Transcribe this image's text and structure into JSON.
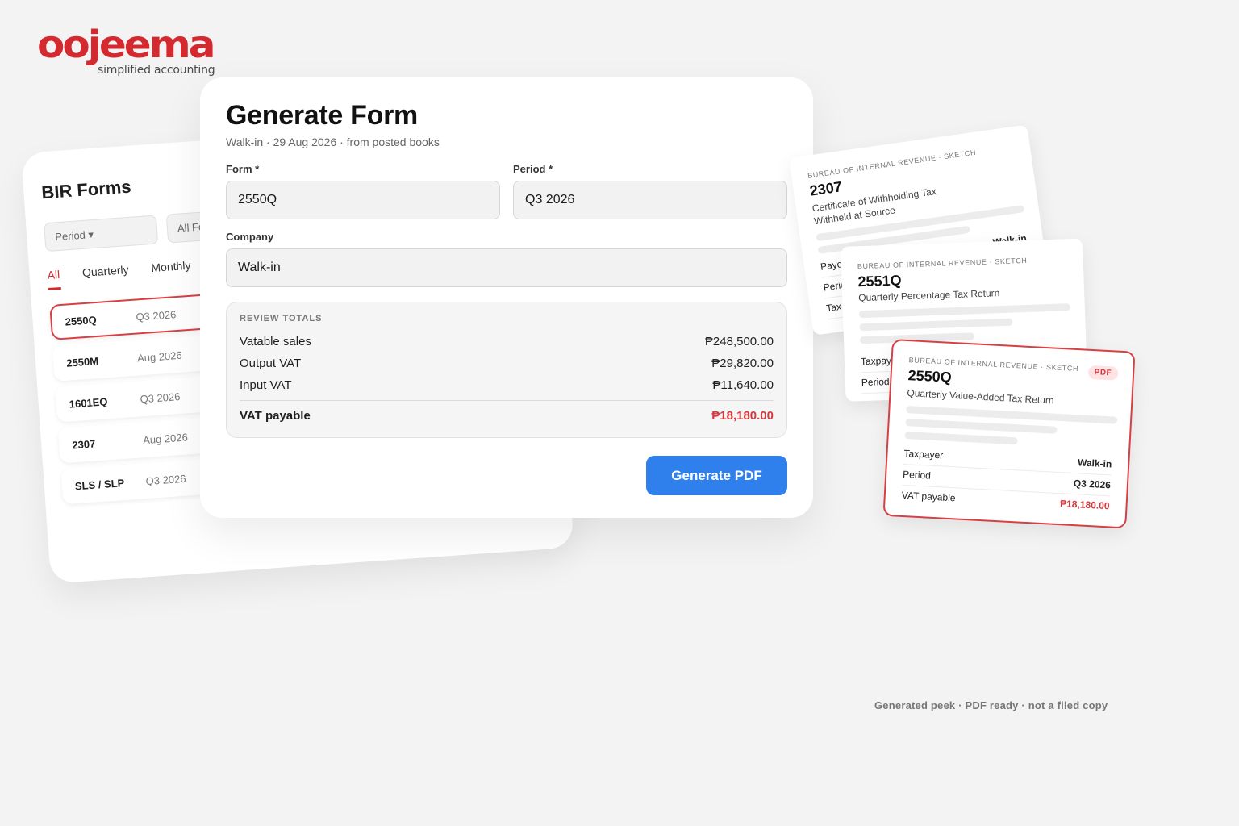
{
  "brand": {
    "name": "oojeema",
    "tagline": "simplified accounting",
    "accent": "#d42a2f"
  },
  "bir": {
    "title": "BIR Forms",
    "filters": {
      "period": "Period ▾",
      "forms": "All Fo"
    },
    "tabs": [
      "All",
      "Quarterly",
      "Monthly"
    ],
    "rows": [
      {
        "code": "2550Q",
        "period": "Q3 2026"
      },
      {
        "code": "2550M",
        "period": "Aug 2026"
      },
      {
        "code": "1601EQ",
        "period": "Q3 2026"
      },
      {
        "code": "2307",
        "period": "Aug 2026"
      },
      {
        "code": "SLS / SLP",
        "period": "Q3 2026"
      }
    ]
  },
  "form": {
    "title": "Generate Form",
    "subtitle": "Walk-in · 29 Aug 2026 · from posted books",
    "form_label": "Form *",
    "form_value": "2550Q",
    "period_label": "Period *",
    "period_value": "Q3 2026",
    "company_label": "Company",
    "company_value": "Walk-in",
    "review": {
      "heading": "REVIEW TOTALS",
      "vatable_label": "Vatable sales",
      "vatable_value": "₱248,500.00",
      "output_label": "Output VAT",
      "output_value": "₱29,820.00",
      "input_label": "Input VAT",
      "input_value": "₱11,640.00",
      "payable_label": "VAT payable",
      "payable_value": "₱18,180.00"
    },
    "button": "Generate PDF",
    "button_color": "#2f80ed"
  },
  "docs": {
    "d1": {
      "head": "BUREAU OF INTERNAL REVENUE · SKETCH",
      "code": "2307",
      "title1": "Certificate of Withholding Tax",
      "title2": "Withheld at Source",
      "k1": "Payor",
      "v1": "Walk-in",
      "k2": "Period",
      "k3": "Tax w"
    },
    "d2": {
      "head": "BUREAU OF INTERNAL REVENUE · SKETCH",
      "code": "2551Q",
      "title": "Quarterly Percentage Tax Return",
      "k1": "Taxpay",
      "k2": "Period"
    },
    "d3": {
      "head": "BUREAU OF INTERNAL REVENUE · SKETCH",
      "code": "2550Q",
      "title": "Quarterly Value-Added Tax Return",
      "badge": "PDF",
      "k1": "Taxpayer",
      "v1": "Walk-in",
      "k2": "Period",
      "v2": "Q3 2026",
      "k3": "VAT payable",
      "v3": "₱18,180.00"
    }
  },
  "footer": "Generated peek · PDF ready · not a filed copy"
}
